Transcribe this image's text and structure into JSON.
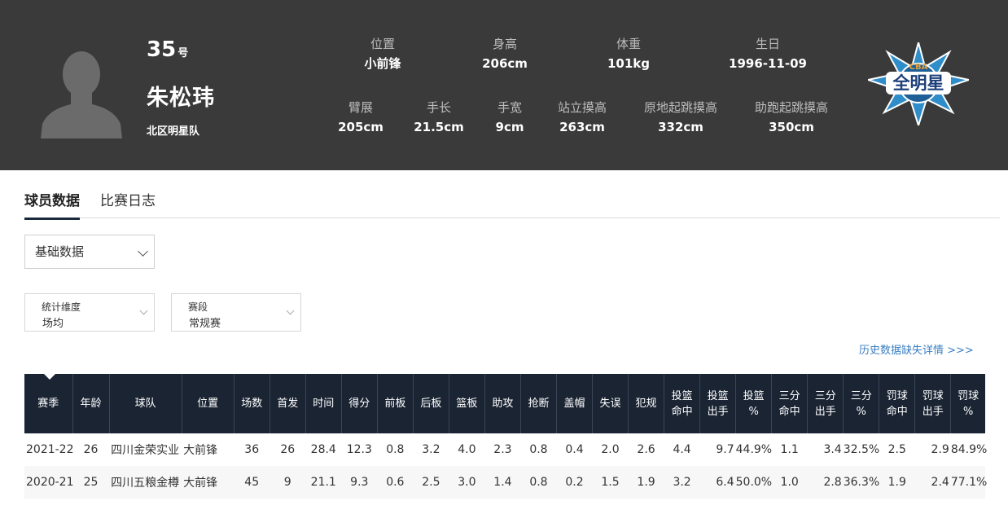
{
  "player": {
    "number": "35",
    "number_suffix": "号",
    "name": "朱松玮",
    "team": "北区明星队"
  },
  "bio": [
    {
      "label": "位置",
      "value": "小前锋"
    },
    {
      "label": "身高",
      "value": "206cm"
    },
    {
      "label": "体重",
      "value": "101kg"
    },
    {
      "label": "生日",
      "value": "1996-11-09"
    },
    {
      "label": "臂展",
      "value": "205cm"
    },
    {
      "label": "手长",
      "value": "21.5cm"
    },
    {
      "label": "手宽",
      "value": "9cm"
    },
    {
      "label": "站立摸高",
      "value": "263cm"
    },
    {
      "label": "原地起跳摸高",
      "value": "332cm"
    },
    {
      "label": "助跑起跳摸高",
      "value": "350cm"
    }
  ],
  "logo": {
    "text_top": "CBA",
    "text_main": "全明星"
  },
  "tabs": [
    "球员数据",
    "比赛日志"
  ],
  "filters": {
    "main": "基础数据",
    "dim_label": "统计维度",
    "dim_value": "场均",
    "stage_label": "赛段",
    "stage_value": "常规赛"
  },
  "history_link": "历史数据缺失详情 >>>",
  "table": {
    "headers": [
      [
        "赛季"
      ],
      [
        "年龄"
      ],
      [
        "球队"
      ],
      [
        "位置"
      ],
      [
        "场数"
      ],
      [
        "首发"
      ],
      [
        "时间"
      ],
      [
        "得分"
      ],
      [
        "前板"
      ],
      [
        "后板"
      ],
      [
        "篮板"
      ],
      [
        "助攻"
      ],
      [
        "抢断"
      ],
      [
        "盖帽"
      ],
      [
        "失误"
      ],
      [
        "犯规"
      ],
      [
        "投篮",
        "命中"
      ],
      [
        "投篮",
        "出手"
      ],
      [
        "投篮",
        "%"
      ],
      [
        "三分",
        "命中"
      ],
      [
        "三分",
        "出手"
      ],
      [
        "三分",
        "%"
      ],
      [
        "罚球",
        "命中"
      ],
      [
        "罚球",
        "出手"
      ],
      [
        "罚球",
        "%"
      ]
    ],
    "rows": [
      [
        "2021-22",
        "26",
        "四川金荣实业",
        "大前锋",
        "36",
        "26",
        "28.4",
        "12.3",
        "0.8",
        "3.2",
        "4.0",
        "2.3",
        "0.8",
        "0.4",
        "2.0",
        "2.6",
        "4.4",
        "9.7",
        "44.9%",
        "1.1",
        "3.4",
        "32.5%",
        "2.5",
        "2.9",
        "84.9%"
      ],
      [
        "2020-21",
        "25",
        "四川五粮金樽",
        "大前锋",
        "45",
        "9",
        "21.1",
        "9.3",
        "0.6",
        "2.5",
        "3.0",
        "1.4",
        "0.8",
        "0.2",
        "1.5",
        "1.9",
        "3.2",
        "6.4",
        "50.0%",
        "1.0",
        "2.8",
        "36.3%",
        "1.9",
        "2.4",
        "77.1%"
      ]
    ]
  },
  "colors": {
    "header_bg": "#3a3a3a",
    "table_header_bg": "#1a2433",
    "link": "#3a7fc2"
  }
}
